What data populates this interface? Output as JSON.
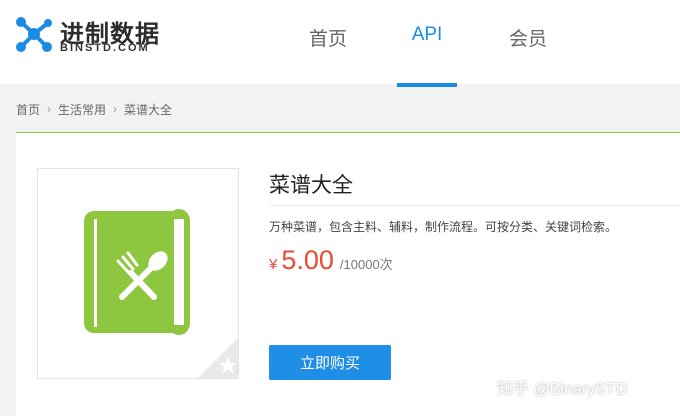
{
  "logo": {
    "title": "进制数据",
    "subtitle": "BINSTD.COM",
    "icon": "molecule-logo-icon",
    "brand_color": "#1a8ce6"
  },
  "nav": {
    "items": [
      {
        "label": "首页",
        "active": false
      },
      {
        "label": "API",
        "active": true
      },
      {
        "label": "会员",
        "active": false
      }
    ],
    "active_color": "#1a8ce6"
  },
  "breadcrumb": {
    "items": [
      "首页",
      "生活常用",
      "菜谱大全"
    ],
    "separator_icon": "chevron-right-icon"
  },
  "product": {
    "title": "菜谱大全",
    "description": "万种菜谱，包含主料、辅料，制作流程。可按分类、关键词检索。",
    "price_currency": "¥",
    "price_value": "5.00",
    "price_unit": "/10000次",
    "price_color": "#e94b35",
    "image_icon": "recipe-book-icon",
    "image_color": "#8dc63f",
    "corner_icon": "star-icon",
    "buy_label": "立即购买",
    "buy_color": "#1f8ee6"
  },
  "watermark": "知乎 @BinarySTD"
}
